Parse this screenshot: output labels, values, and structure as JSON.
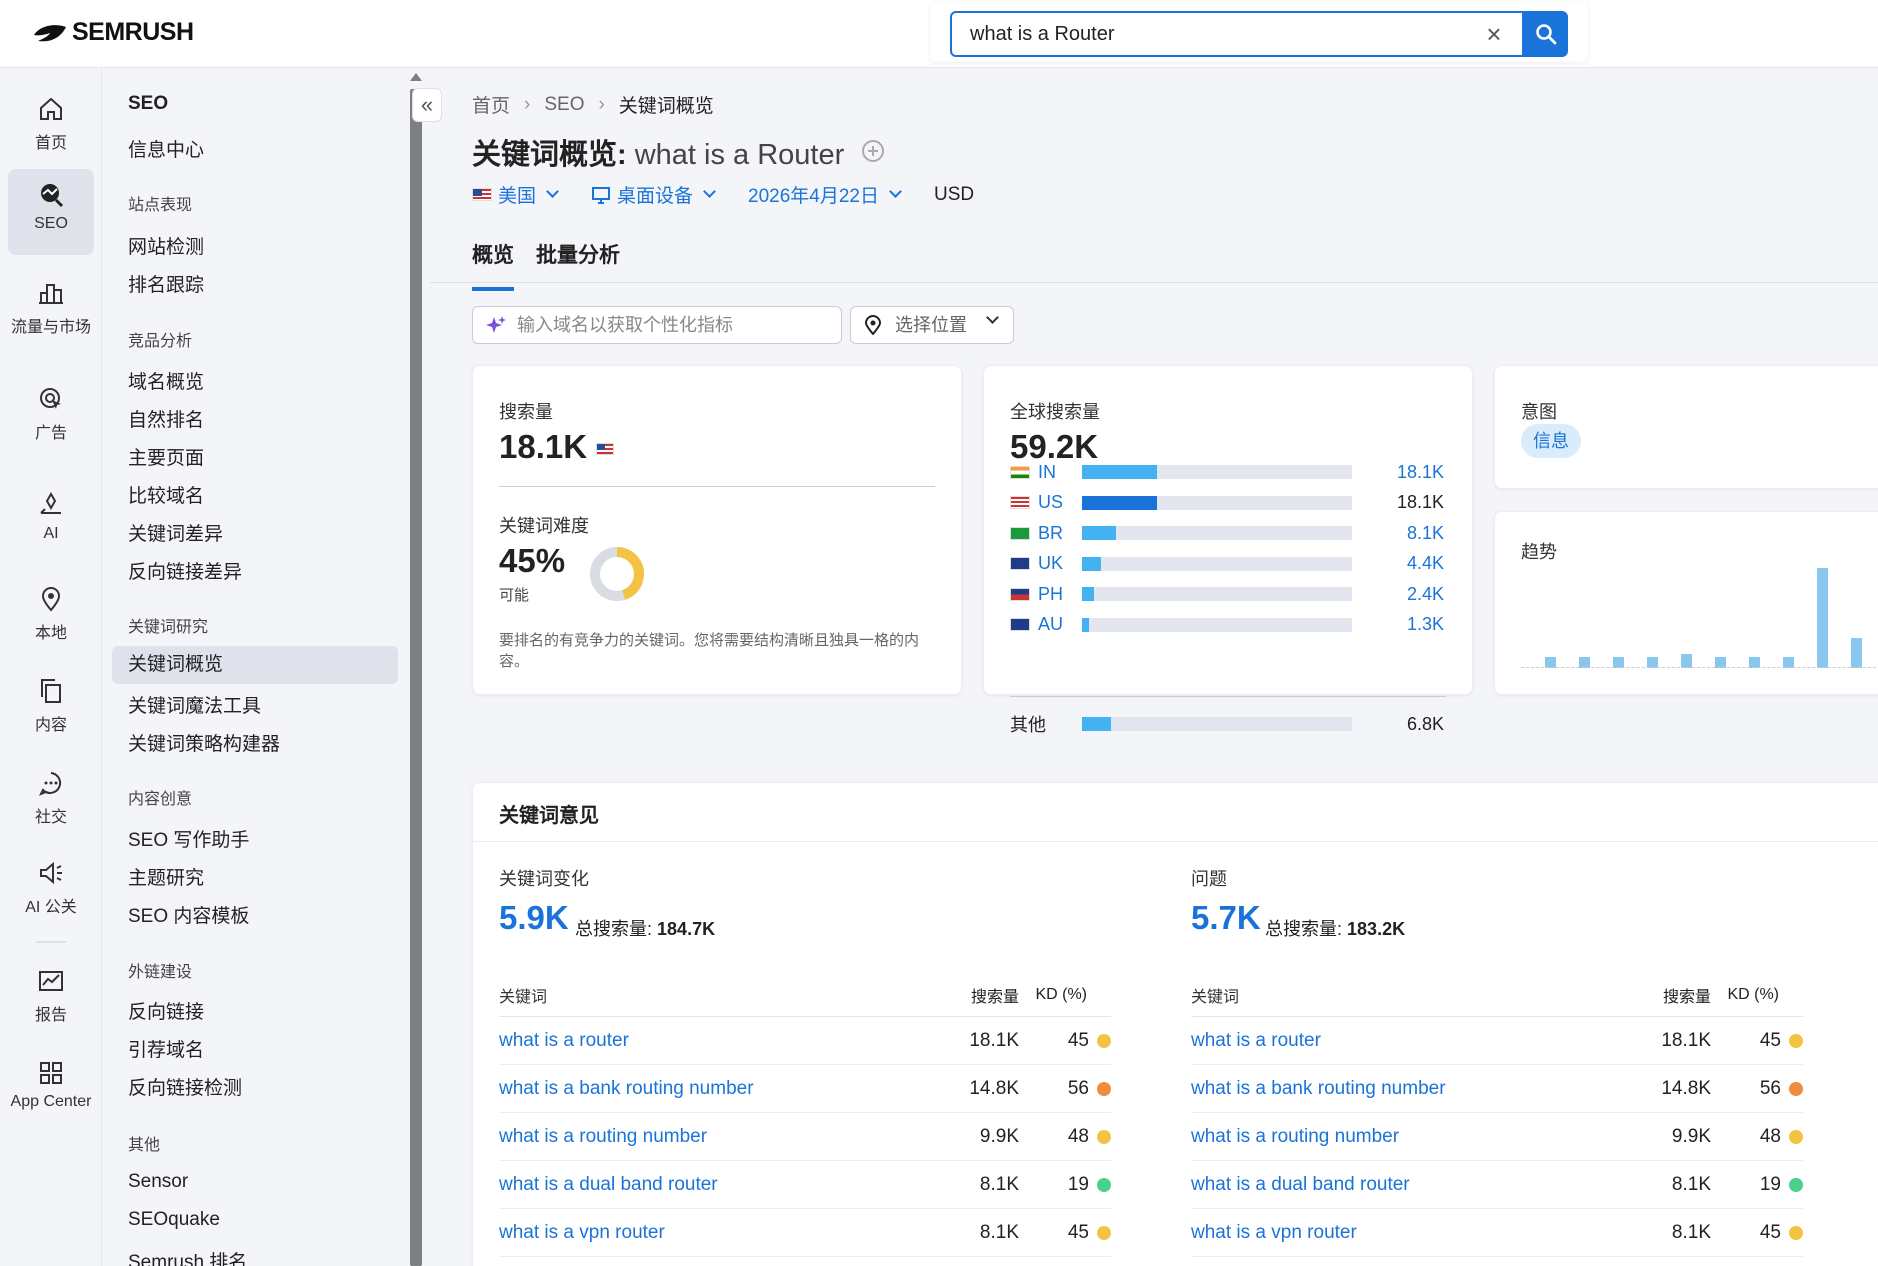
{
  "app": {
    "logo_text": "SEMRUSH"
  },
  "search": {
    "value": "what is a Router"
  },
  "rail": [
    {
      "label": "首页",
      "icon": "home-icon"
    },
    {
      "label": "SEO",
      "icon": "seo-icon",
      "active": true
    },
    {
      "label": "流量与市场",
      "icon": "traffic-market-icon"
    },
    {
      "label": "广告",
      "icon": "ads-icon"
    },
    {
      "label": "AI",
      "icon": "ai-icon"
    },
    {
      "label": "本地",
      "icon": "local-pin-icon"
    },
    {
      "label": "内容",
      "icon": "content-icon"
    },
    {
      "label": "社交",
      "icon": "social-icon"
    },
    {
      "label": "AI 公关",
      "icon": "ai-pr-icon"
    },
    {
      "label": "报告",
      "icon": "report-icon"
    },
    {
      "label": "App Center",
      "icon": "app-center-icon"
    }
  ],
  "subnav": {
    "title": "SEO",
    "info_center": "信息中心",
    "groups": [
      {
        "heading": "站点表现",
        "items": [
          "网站检测",
          "排名跟踪"
        ]
      },
      {
        "heading": "竞品分析",
        "items": [
          "域名概览",
          "自然排名",
          "主要页面",
          "比较域名",
          "关键词差异",
          "反向链接差异"
        ]
      },
      {
        "heading": "关键词研究",
        "items": [
          "关键词概览",
          "关键词魔法工具",
          "关键词策略构建器"
        ]
      },
      {
        "heading": "内容创意",
        "items": [
          "SEO 写作助手",
          "主题研究",
          "SEO 内容模板"
        ]
      },
      {
        "heading": "外链建设",
        "items": [
          "反向链接",
          "引荐域名",
          "反向链接检测"
        ]
      },
      {
        "heading": "其他",
        "items": [
          "Sensor",
          "SEOquake",
          "Semrush 排名"
        ]
      }
    ],
    "active_item": "关键词概览"
  },
  "breadcrumb": [
    "首页",
    "SEO",
    "关键词概览"
  ],
  "page": {
    "title_prefix": "关键词概览:",
    "keyword": "what is a Router",
    "filters": {
      "country": "美国",
      "device": "桌面设备",
      "date": "2026年4月22日",
      "currency": "USD"
    },
    "tabs": [
      "概览",
      "批量分析"
    ],
    "domain_placeholder": "输入域名以获取个性化指标",
    "location_placeholder": "选择位置"
  },
  "volume_card": {
    "label": "搜索量",
    "value": "18.1K",
    "kd_label": "关键词难度",
    "kd_value": "45%",
    "kd_percent": 45,
    "kd_status": "可能",
    "kd_desc": "要排名的有竞争力的关键词。您将需要结构清晰且独具一格的内容。"
  },
  "global_card": {
    "label": "全球搜索量",
    "value": "59.2K",
    "rows": [
      {
        "code": "IN",
        "value": "18.1K",
        "fraction": 0.31,
        "highlight": false
      },
      {
        "code": "US",
        "value": "18.1K",
        "fraction": 0.31,
        "highlight": true
      },
      {
        "code": "BR",
        "value": "8.1K",
        "fraction": 0.14,
        "highlight": false
      },
      {
        "code": "UK",
        "value": "4.4K",
        "fraction": 0.08,
        "highlight": false
      },
      {
        "code": "PH",
        "value": "2.4K",
        "fraction": 0.05,
        "highlight": false
      },
      {
        "code": "AU",
        "value": "1.3K",
        "fraction": 0.03,
        "highlight": false
      }
    ],
    "other": {
      "label": "其他",
      "value": "6.8K",
      "fraction": 0.12
    }
  },
  "intent_card": {
    "label": "意图",
    "badge": "信息"
  },
  "trend_card": {
    "label": "趋势",
    "values": [
      0.11,
      0.11,
      0.11,
      0.11,
      0.14,
      0.11,
      0.11,
      0.11,
      1.0,
      0.3
    ]
  },
  "ideas": {
    "title": "关键词意见",
    "variations": {
      "label": "关键词变化",
      "count": "5.9K",
      "total_label": "总搜索量:",
      "total_value": "184.7K",
      "headers": [
        "关键词",
        "搜索量",
        "KD (%)"
      ],
      "rows": [
        {
          "kw": "what is a router",
          "vol": "18.1K",
          "kd": "45",
          "color": "#f5c343"
        },
        {
          "kw": "what is a bank routing number",
          "vol": "14.8K",
          "kd": "56",
          "color": "#f08c3e"
        },
        {
          "kw": "what is a routing number",
          "vol": "9.9K",
          "kd": "48",
          "color": "#f5c343"
        },
        {
          "kw": "what is a dual band router",
          "vol": "8.1K",
          "kd": "19",
          "color": "#49d08a"
        },
        {
          "kw": "what is a vpn router",
          "vol": "8.1K",
          "kd": "45",
          "color": "#f5c343"
        }
      ]
    },
    "questions": {
      "label": "问题",
      "count": "5.7K",
      "total_label": "总搜索量:",
      "total_value": "183.2K",
      "headers": [
        "关键词",
        "搜索量",
        "KD (%)"
      ],
      "rows": [
        {
          "kw": "what is a router",
          "vol": "18.1K",
          "kd": "45",
          "color": "#f5c343"
        },
        {
          "kw": "what is a bank routing number",
          "vol": "14.8K",
          "kd": "56",
          "color": "#f08c3e"
        },
        {
          "kw": "what is a routing number",
          "vol": "9.9K",
          "kd": "48",
          "color": "#f5c343"
        },
        {
          "kw": "what is a dual band router",
          "vol": "8.1K",
          "kd": "19",
          "color": "#49d08a"
        },
        {
          "kw": "what is a vpn router",
          "vol": "8.1K",
          "kd": "45",
          "color": "#f5c343"
        }
      ]
    }
  }
}
